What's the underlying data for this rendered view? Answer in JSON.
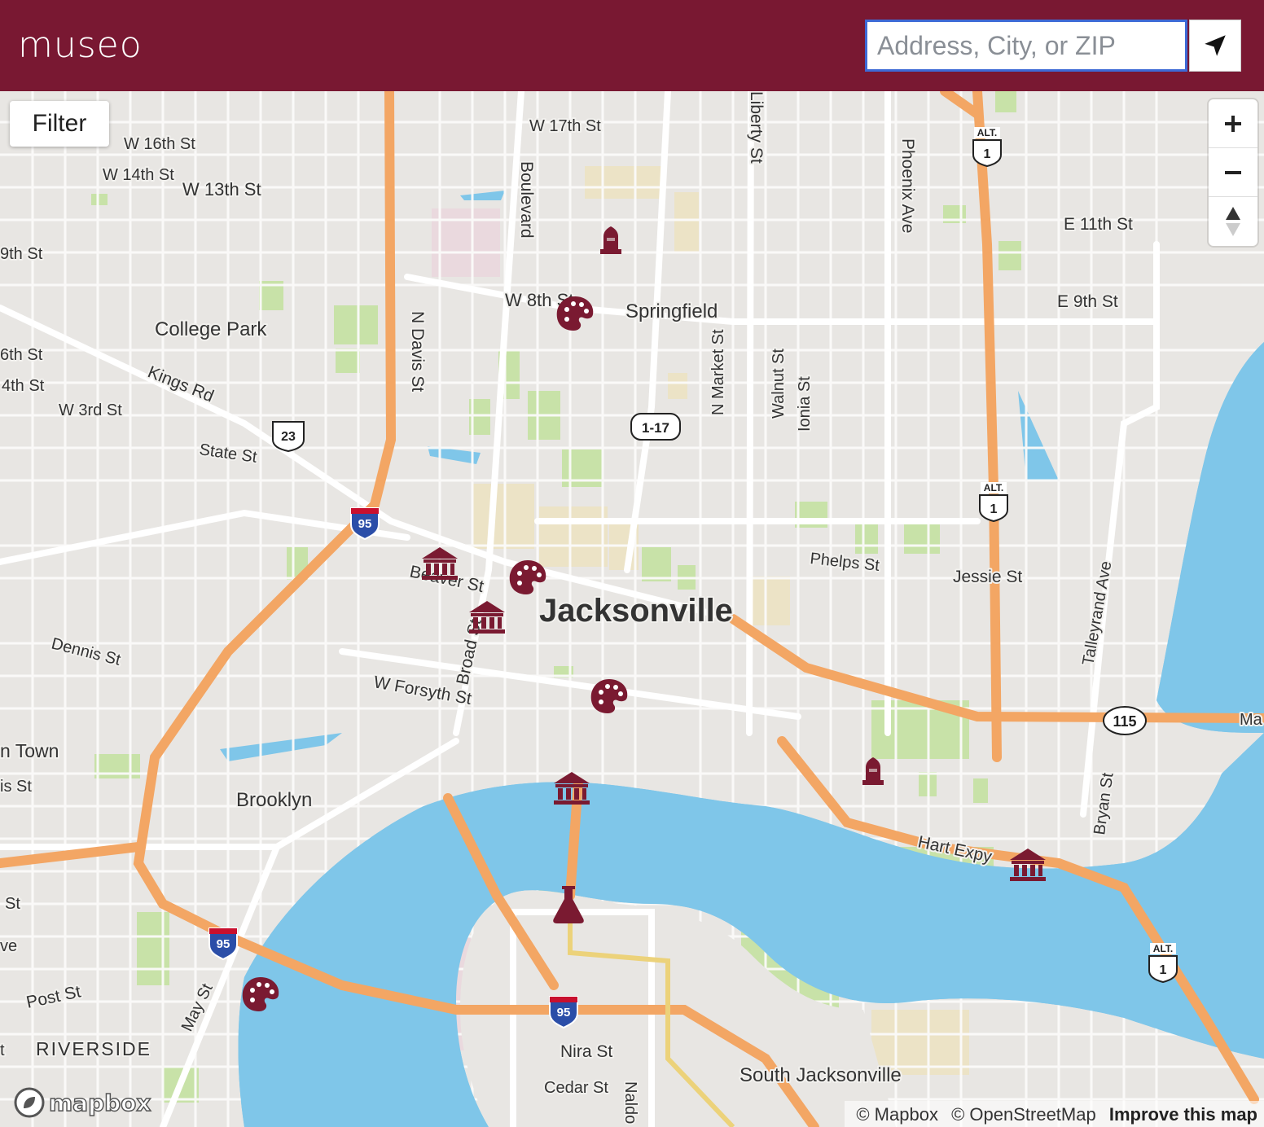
{
  "header": {
    "brand": "museo",
    "search_placeholder": "Address, City, or ZIP",
    "locate_icon": "navigation-arrow-icon"
  },
  "controls": {
    "filter_label": "Filter",
    "zoom_in": "+",
    "zoom_out": "−",
    "compass_icon": "compass-icon"
  },
  "attribution": {
    "mapbox": "© Mapbox",
    "osm": "© OpenStreetMap",
    "improve": "Improve this map",
    "logo_text": "mapbox"
  },
  "colors": {
    "header": "#791832",
    "marker": "#7a1a31",
    "water": "#7fc6e9",
    "park": "#c8e2a8",
    "highway": "#f3a664",
    "land": "#e8e6e3",
    "road": "#ffffff"
  },
  "map_labels": {
    "city": "Jacksonville",
    "neighborhoods": [
      "College Park",
      "Springfield",
      "Brooklyn",
      "RIVERSIDE",
      "South Jacksonville",
      "n Town"
    ],
    "streets": [
      "W 17th St",
      "W 16th St",
      "W 14th St",
      "W 13th St",
      "9th St",
      "Boulevard",
      "Liberty St",
      "Phoenix Ave",
      "E 11th St",
      "E 9th St",
      "W 8th St",
      "6th St",
      "4th St",
      "W 3rd St",
      "Kings Rd",
      "N Davis St",
      "State St",
      "N Market St",
      "Walnut St",
      "Ionia St",
      "Phelps St",
      "Jessie St",
      "Talleyrand Ave",
      "Beaver St",
      "Broad St",
      "Dennis St",
      "W Forsyth St",
      "is St",
      "Hart Expy",
      "Bryan St",
      "Post St",
      "ve",
      "St",
      "May St",
      "Nira St",
      "Cedar St",
      "Naldo",
      "Ma",
      "t"
    ],
    "shields": [
      "95",
      "95",
      "95",
      "23",
      "1-17",
      "115",
      "1",
      "1",
      "1"
    ],
    "shield_alt": "ALT."
  },
  "markers": [
    {
      "type": "monument",
      "icon": "monument-icon"
    },
    {
      "type": "art",
      "icon": "palette-icon"
    },
    {
      "type": "museum",
      "icon": "museum-icon"
    },
    {
      "type": "art",
      "icon": "palette-icon"
    },
    {
      "type": "museum",
      "icon": "museum-icon"
    },
    {
      "type": "art",
      "icon": "palette-icon"
    },
    {
      "type": "museum",
      "icon": "museum-icon"
    },
    {
      "type": "monument",
      "icon": "monument-icon"
    },
    {
      "type": "museum",
      "icon": "museum-icon"
    },
    {
      "type": "science",
      "icon": "flask-icon"
    },
    {
      "type": "art",
      "icon": "palette-icon"
    }
  ]
}
